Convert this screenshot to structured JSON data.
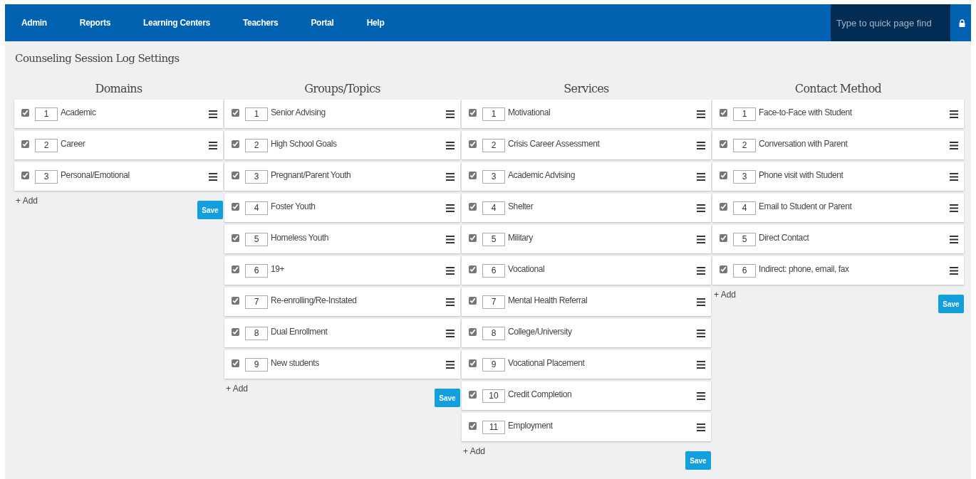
{
  "nav": {
    "items": [
      "Admin",
      "Reports",
      "Learning Centers",
      "Teachers",
      "Portal",
      "Help"
    ],
    "search": {
      "placeholder": "Type to quick page find"
    }
  },
  "page_title": "Counseling Session Log Settings",
  "columns": [
    {
      "title": "Domains",
      "add_label": "+ Add",
      "save_label": "Save",
      "items": [
        {
          "checked": true,
          "order": "1",
          "label": "Academic"
        },
        {
          "checked": true,
          "order": "2",
          "label": "Career"
        },
        {
          "checked": true,
          "order": "3",
          "label": "Personal/Emotional"
        }
      ]
    },
    {
      "title": "Groups/Topics",
      "add_label": "+ Add",
      "save_label": "Save",
      "items": [
        {
          "checked": true,
          "order": "1",
          "label": "Senior Advising"
        },
        {
          "checked": true,
          "order": "2",
          "label": "High School Goals"
        },
        {
          "checked": true,
          "order": "3",
          "label": "Pregnant/Parent Youth"
        },
        {
          "checked": true,
          "order": "4",
          "label": "Foster Youth"
        },
        {
          "checked": true,
          "order": "5",
          "label": "Homeless Youth"
        },
        {
          "checked": true,
          "order": "6",
          "label": "19+"
        },
        {
          "checked": true,
          "order": "7",
          "label": "Re-enrolling/Re-Instated"
        },
        {
          "checked": true,
          "order": "8",
          "label": "Dual Enrollment"
        },
        {
          "checked": true,
          "order": "9",
          "label": "New students"
        }
      ]
    },
    {
      "title": "Services",
      "add_label": "+ Add",
      "save_label": "Save",
      "items": [
        {
          "checked": true,
          "order": "1",
          "label": "Motivational"
        },
        {
          "checked": true,
          "order": "2",
          "label": "Crisis Career Assessment"
        },
        {
          "checked": true,
          "order": "3",
          "label": "Academic Advising"
        },
        {
          "checked": true,
          "order": "4",
          "label": "Shelter"
        },
        {
          "checked": true,
          "order": "5",
          "label": "Military"
        },
        {
          "checked": true,
          "order": "6",
          "label": "Vocational"
        },
        {
          "checked": true,
          "order": "7",
          "label": "Mental Health Referral"
        },
        {
          "checked": true,
          "order": "8",
          "label": "College/University"
        },
        {
          "checked": true,
          "order": "9",
          "label": "Vocational Placement"
        },
        {
          "checked": true,
          "order": "10",
          "label": "Credit Completion"
        },
        {
          "checked": true,
          "order": "11",
          "label": "Employment"
        }
      ]
    },
    {
      "title": "Contact Method",
      "add_label": "+ Add",
      "save_label": "Save",
      "items": [
        {
          "checked": true,
          "order": "1",
          "label": "Face-to-Face with Student"
        },
        {
          "checked": true,
          "order": "2",
          "label": "Conversation with Parent"
        },
        {
          "checked": true,
          "order": "3",
          "label": "Phone visit with Student"
        },
        {
          "checked": true,
          "order": "4",
          "label": "Email to Student or Parent"
        },
        {
          "checked": true,
          "order": "5",
          "label": "Direct Contact"
        },
        {
          "checked": true,
          "order": "6",
          "label": "Indirect: phone, email, fax"
        }
      ]
    }
  ]
}
